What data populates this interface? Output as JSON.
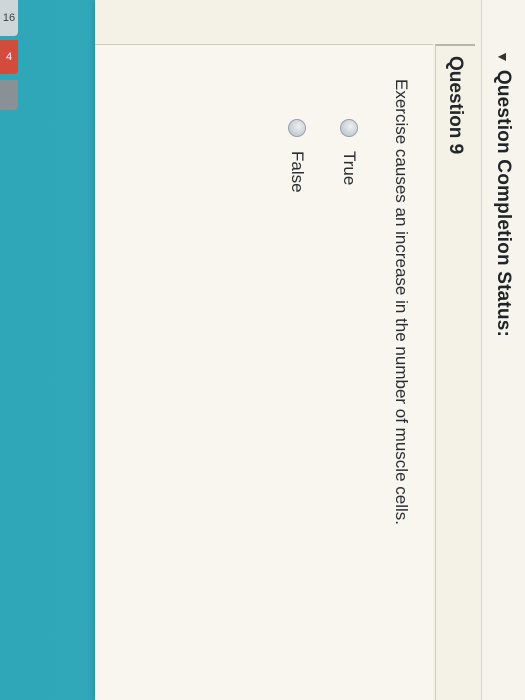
{
  "side_tabs": {
    "tab_a": "16",
    "tab_b": "4"
  },
  "status": {
    "title": "Question Completion Status:"
  },
  "question": {
    "title": "Question 9",
    "text": "Exercise causes an increase in the number of muscle cells.",
    "options": [
      {
        "label": "True"
      },
      {
        "label": "False"
      }
    ]
  },
  "colors": {
    "background": "#2fa7b9",
    "page": "#f4f1e6",
    "alert_tab": "#d24b3c"
  }
}
